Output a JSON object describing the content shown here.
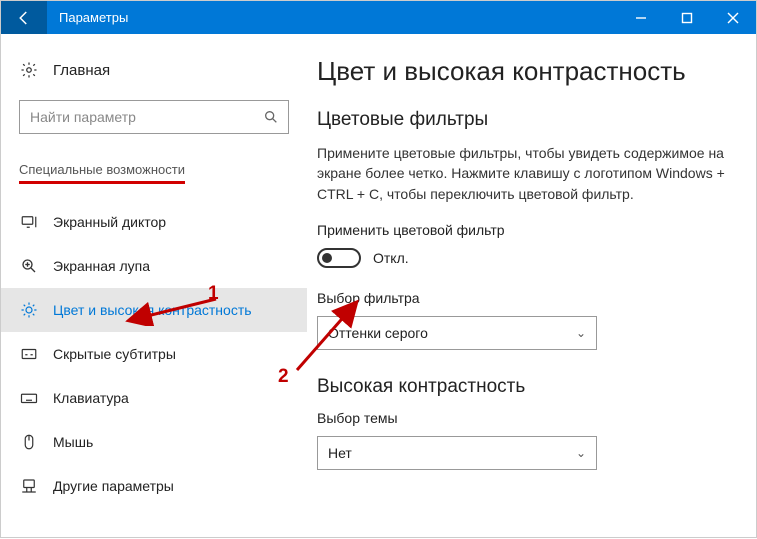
{
  "titlebar": {
    "title": "Параметры"
  },
  "sidebar": {
    "home_label": "Главная",
    "search_placeholder": "Найти параметр",
    "category": "Специальные возможности",
    "items": [
      {
        "label": "Экранный диктор"
      },
      {
        "label": "Экранная лупа"
      },
      {
        "label": "Цвет и высокая контрастность"
      },
      {
        "label": "Скрытые субтитры"
      },
      {
        "label": "Клавиатура"
      },
      {
        "label": "Мышь"
      },
      {
        "label": "Другие параметры"
      }
    ]
  },
  "main": {
    "title": "Цвет и высокая контрастность",
    "section1_title": "Цветовые фильтры",
    "section1_desc": "Примените цветовые фильтры, чтобы увидеть содержимое на экране более четко. Нажмите клавишу с логотипом Windows + CTRL + C, чтобы переключить цветовой фильтр.",
    "toggle_header": "Применить цветовой фильтр",
    "toggle_state": "Откл.",
    "filter_label": "Выбор фильтра",
    "filter_value": "Оттенки серого",
    "section2_title": "Высокая контрастность",
    "theme_label": "Выбор темы",
    "theme_value": "Нет"
  },
  "annotations": {
    "num1": "1",
    "num2": "2"
  }
}
